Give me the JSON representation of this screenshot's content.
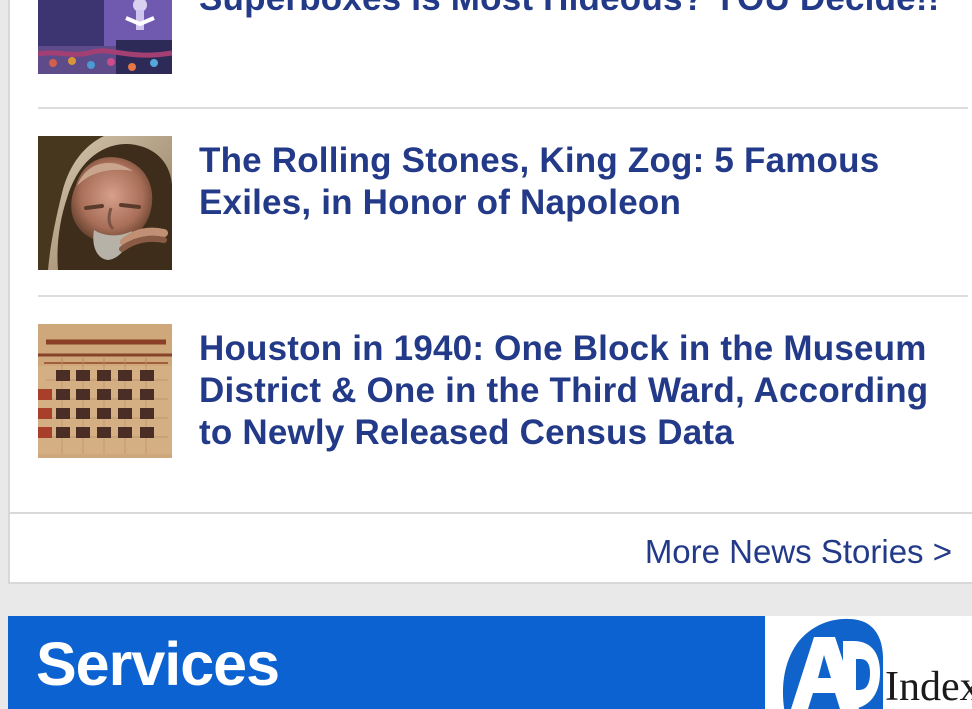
{
  "stories": [
    {
      "title": "Superboxes Is Most Hideous? YOU Decide!!",
      "image_icon": "living-room-photo-icon"
    },
    {
      "title": "The Rolling Stones, King Zog: 5 Famous Exiles, in Honor of Napoleon",
      "image_icon": "hooded-man-photo-icon"
    },
    {
      "title": "Houston in 1940: One Block in the Museum District & One in the Third Ward, According to Newly Released Census Data",
      "image_icon": "calendar-photo-icon"
    }
  ],
  "more_news_link": "More News Stories >",
  "services": {
    "title": "Services"
  },
  "ad_logo": {
    "word": "Index",
    "mark": "AP"
  },
  "colors": {
    "link": "#233a88",
    "services_bg": "#0b62d0",
    "panel_bg": "#ffffff",
    "page_bg": "#e9e9e9"
  }
}
